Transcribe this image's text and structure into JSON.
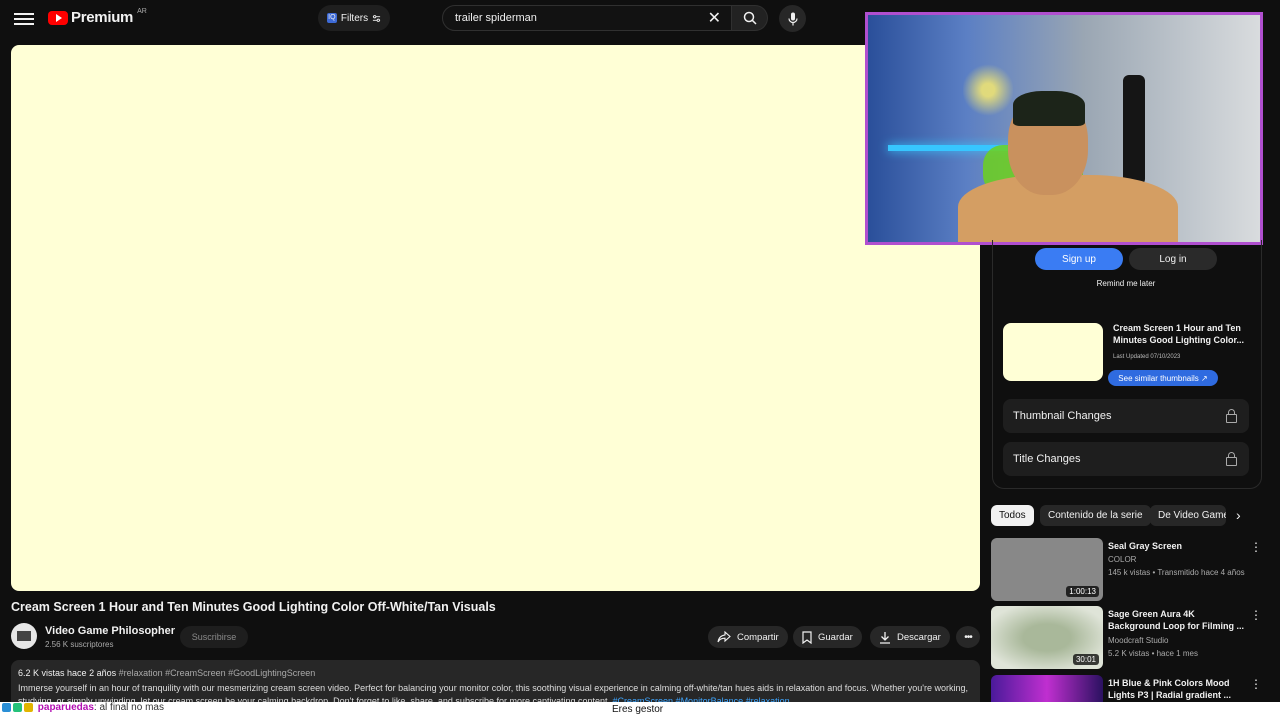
{
  "header": {
    "brand": "Premium",
    "region": "AR",
    "filters_label": "Filters",
    "filters_badge": "IQ",
    "search_value": "trailer spiderman"
  },
  "panel": {
    "signup": "Sign up",
    "login": "Log in",
    "remind": "Remind me later",
    "card_title": "Cream Screen 1 Hour and Ten Minutes Good Lighting Color...",
    "last_updated": "Last Updated 07/10/2023",
    "similar": "See similar thumbnails ↗",
    "thumbnail_changes": "Thumbnail Changes",
    "title_changes": "Title Changes"
  },
  "chips": [
    "Todos",
    "Contenido de la serie",
    "De Video Game Philosopher"
  ],
  "related": [
    {
      "title": "Seal Gray Screen",
      "channel": "COLOR",
      "meta": "145 k vistas • Transmitido hace 4 años",
      "duration": "1:00:13",
      "color": "#888888"
    },
    {
      "title": "Sage Green Aura 4K Background Loop for Filming ...",
      "channel": "Moodcraft Studio",
      "meta": "5.2 K vistas • hace 1 mes",
      "duration": "30:01",
      "color": "#a9b89a"
    },
    {
      "title": "1H Blue & Pink Colors Mood Lights P3 | Radial gradient ...",
      "channel": "",
      "meta": "",
      "duration": "",
      "color": "#6b2bb8"
    }
  ],
  "video": {
    "title": "Cream Screen 1 Hour and Ten Minutes Good Lighting Color Off-White/Tan Visuals",
    "channel": "Video Game Philosopher",
    "subscribers": "2.56 K suscriptores",
    "subscribe": "Suscribirse",
    "share": "Compartir",
    "save": "Guardar",
    "download": "Descargar",
    "views": "6.2 K vistas",
    "ago": "hace 2 años",
    "hashtags": "#relaxation #CreamScreen #GoodLightingScreen",
    "description": "Immerse yourself in an hour of tranquility with our mesmerizing cream screen video. Perfect for balancing your monitor color, this soothing visual experience in calming off-white/tan hues aids in relaxation and focus. Whether you're working, studying, or simply unwinding, let our cream screen be your calming backdrop. Don't forget to like, share, and subscribe for more captivating content.",
    "desc_tags": "#CreamScreen #MonitorBalance #relaxation"
  },
  "overlay": {
    "chat_user": "paparuedas",
    "chat_msg": ": al final no mas",
    "center_text": "Eres gestor"
  },
  "colors": {
    "player": "#ffffd6",
    "accent_blue": "#3a7cf3",
    "webcam_border": "#b04fcf"
  }
}
